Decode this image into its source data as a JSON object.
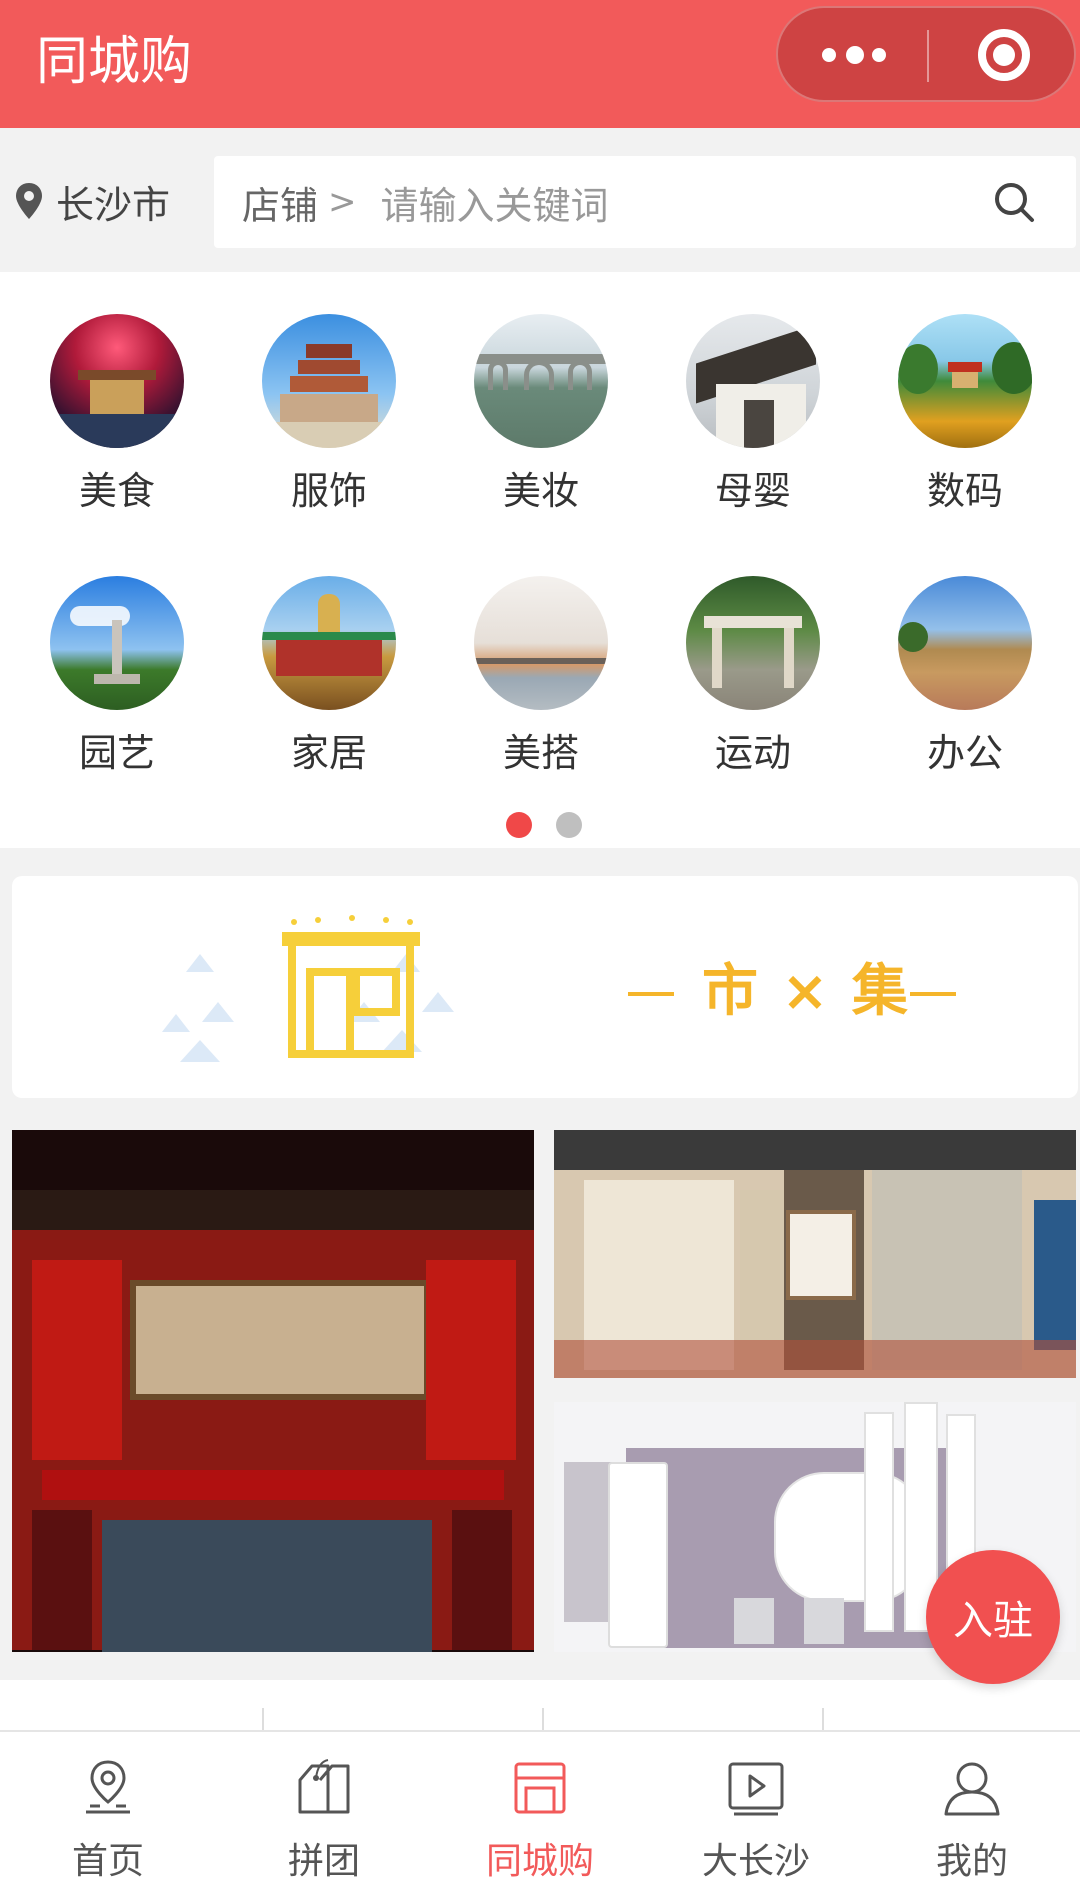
{
  "header": {
    "title": "同城购",
    "more_icon": "more-dots-icon",
    "close_icon": "close-target-icon",
    "background": "#f25a5a"
  },
  "search": {
    "city": "长沙市",
    "scope": "店铺",
    "placeholder": "请输入关键词"
  },
  "categories": [
    {
      "label": "美食"
    },
    {
      "label": "服饰"
    },
    {
      "label": "美妆"
    },
    {
      "label": "母婴"
    },
    {
      "label": "数码"
    },
    {
      "label": "园艺"
    },
    {
      "label": "家居"
    },
    {
      "label": "美搭"
    },
    {
      "label": "运动"
    },
    {
      "label": "办公"
    }
  ],
  "pager": {
    "current": 1,
    "total": 2,
    "active_color": "#f04848",
    "inactive_color": "#bfbfbf"
  },
  "market": {
    "title": "市 × 集",
    "accent": "#f5b52a"
  },
  "join_label": "入驻",
  "nav": [
    {
      "label": "首页",
      "icon": "location-home-icon"
    },
    {
      "label": "拼团",
      "icon": "tag-icon"
    },
    {
      "label": "同城购",
      "icon": "store-icon"
    },
    {
      "label": "大长沙",
      "icon": "video-play-icon"
    },
    {
      "label": "我的",
      "icon": "user-icon"
    }
  ],
  "active_nav": "同城购"
}
